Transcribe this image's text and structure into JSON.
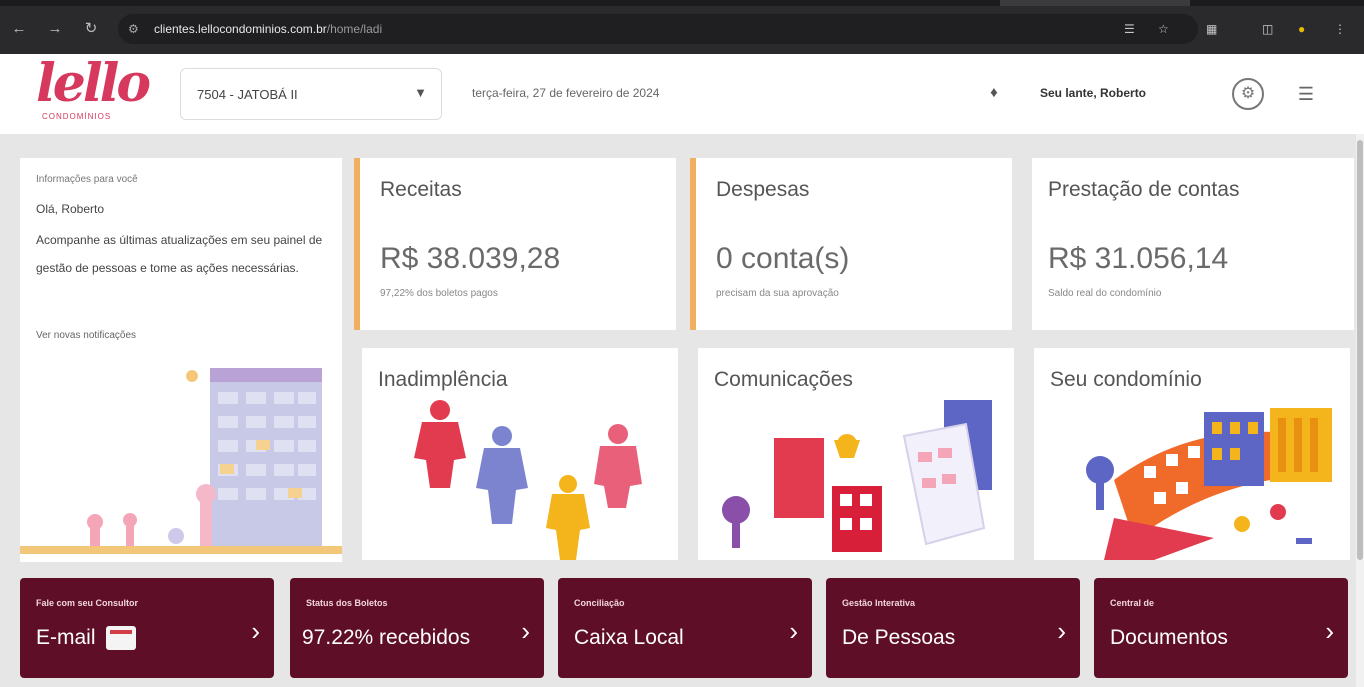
{
  "browser": {
    "url_host": "clientes.lellocondominios.com.br",
    "url_path": "/home/ladi"
  },
  "header": {
    "logo_text": "lello",
    "logo_sub": "CONDOMÍNIOS",
    "condo_select_value": "7504 - JATOBÁ II",
    "date_text": "terça-feira, 27 de fevereiro de 2024",
    "greeting": "Seu lante, Roberto"
  },
  "info": {
    "small_title": "Informações para você",
    "hello": "Olá, Roberto",
    "text": "Acompanhe as últimas atualizações em seu painel de gestão de pessoas e tome as ações necessárias.",
    "link": "Ver novas notificações"
  },
  "kpis": [
    {
      "title": "Receitas",
      "value": "R$ 38.039,28",
      "sub": "97,22% dos boletos pagos"
    },
    {
      "title": "Despesas",
      "value": "0 conta(s)",
      "sub": "precisam da sua aprovação"
    },
    {
      "title": "Prestação de contas",
      "value": "R$ 31.056,14",
      "sub": "Saldo real do condomínio"
    }
  ],
  "cards": [
    {
      "title": "Inadimplência"
    },
    {
      "title": "Comunicações"
    },
    {
      "title": "Seu condomínio"
    }
  ],
  "tiles": [
    {
      "small": "Fale com seu Consultor",
      "main": "E-mail"
    },
    {
      "small": "Status dos Boletos",
      "main": "97.22% recebidos"
    },
    {
      "small": "Conciliação",
      "main": "Caixa Local"
    },
    {
      "small": "Gestão Interativa",
      "main": "De Pessoas"
    },
    {
      "small": "Central de",
      "main": "Documentos"
    }
  ]
}
